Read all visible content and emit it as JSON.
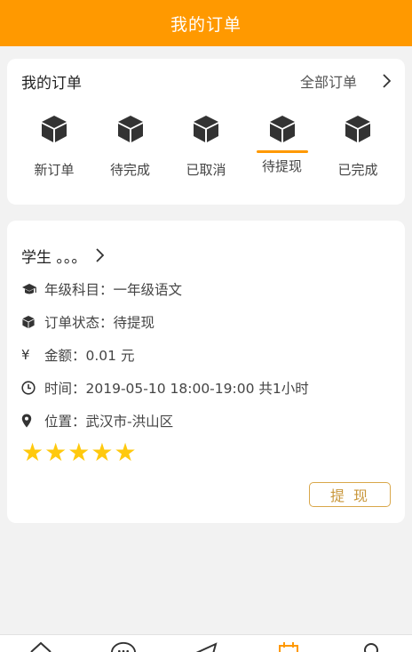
{
  "header": {
    "title": "我的订单"
  },
  "orders": {
    "title": "我的订单",
    "all_orders_label": "全部订单",
    "statuses": [
      {
        "label": "新订单",
        "icon": "box-icon",
        "active": false
      },
      {
        "label": "待完成",
        "icon": "box-icon",
        "active": false
      },
      {
        "label": "已取消",
        "icon": "box-icon",
        "active": false
      },
      {
        "label": "待提现",
        "icon": "box-icon",
        "active": true
      },
      {
        "label": "已完成",
        "icon": "box-icon",
        "active": false
      }
    ]
  },
  "detail": {
    "student": "学生 。。。",
    "grade_subject": "年级科目：一年级语文",
    "order_status": "订单状态：待提现",
    "amount": "金额：0.01 元",
    "time": "时间：2019-05-10 18:00-19:00 共1小时",
    "location": "位置：武汉市-洪山区",
    "rating": 5,
    "withdraw_label": "提现"
  },
  "tabbar": {
    "icons": [
      "home-icon",
      "message-icon",
      "send-icon",
      "calendar-icon",
      "user-icon"
    ],
    "active_index": 3
  },
  "colors": {
    "accent": "#ff9900",
    "star": "#ffc90e",
    "button": "#d9a74a"
  }
}
